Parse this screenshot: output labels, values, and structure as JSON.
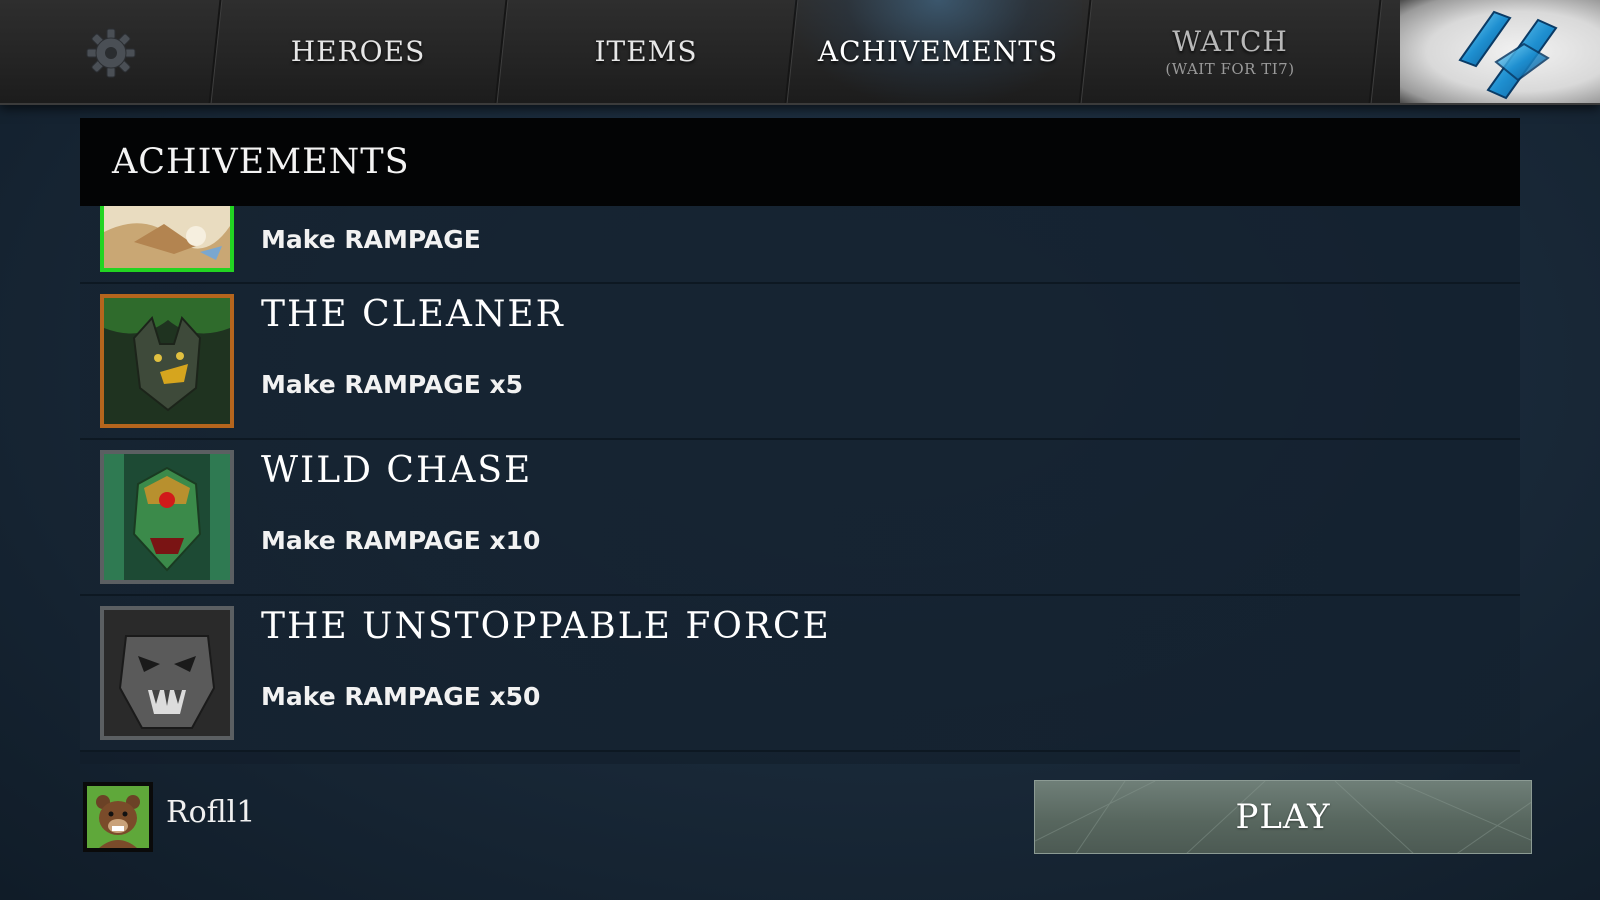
{
  "nav": {
    "settings_icon": "gear-icon",
    "tabs": [
      {
        "label": "HEROES"
      },
      {
        "label": "ITEMS"
      },
      {
        "label": "ACHIVEMENTS"
      },
      {
        "label": "WATCH",
        "sub": "(WAIT FOR TI7)"
      }
    ],
    "logo_icon": "brand-logo-icon"
  },
  "panel": {
    "title": "ACHIVEMENTS",
    "achievements": [
      {
        "title": "",
        "desc": "Make RAMPAGE",
        "icon": "hero-portrait-icon",
        "frame_color": "#22d422"
      },
      {
        "title": "THE CLEANER",
        "desc": "Make RAMPAGE x5",
        "icon": "hero-portrait-icon",
        "frame_color": "#b5651d"
      },
      {
        "title": "WILD CHASE",
        "desc": "Make RAMPAGE x10",
        "icon": "hero-portrait-icon",
        "frame_color": "#5b5f62"
      },
      {
        "title": "THE UNSTOPPABLE FORCE",
        "desc": "Make RAMPAGE x50",
        "icon": "hero-portrait-icon",
        "frame_color": "#5b5f62"
      }
    ]
  },
  "player": {
    "name": "Rofll1",
    "avatar_icon": "bear-avatar-icon"
  },
  "play": {
    "label": "PLAY"
  },
  "colors": {
    "accent_active_tab": "#4678a0",
    "panel_header": "#030405",
    "play_button": "#5f6f68"
  }
}
